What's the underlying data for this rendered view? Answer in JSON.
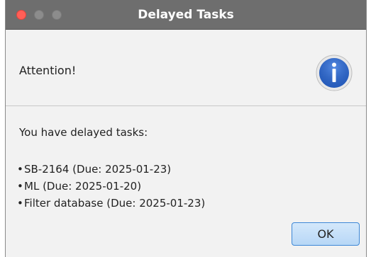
{
  "window": {
    "title": "Delayed Tasks",
    "close_button": "close",
    "minimize_button": "minimize",
    "maximize_button": "maximize"
  },
  "header": {
    "text": "Attention!",
    "icon": "info-icon",
    "icon_color": "#2a63c7"
  },
  "body": {
    "intro": "You have delayed tasks:",
    "tasks": [
      "SB-2164 (Due: 2025-01-23)",
      "ML (Due: 2025-01-20)",
      "Filter database (Due: 2025-01-23)"
    ],
    "bullet": "•"
  },
  "buttons": {
    "ok": "OK"
  },
  "colors": {
    "titlebar": "#6e6e6e",
    "close": "#ff5f57",
    "ok_border": "#3d87d6"
  }
}
